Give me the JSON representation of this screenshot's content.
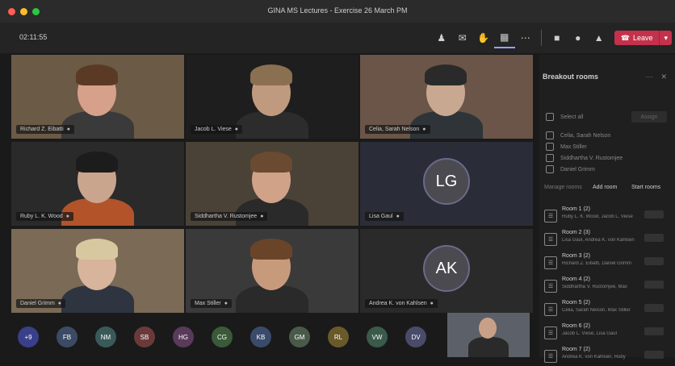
{
  "window": {
    "title": "GINA MS Lectures - Exercise 26 March PM",
    "dot_colors": [
      "#ff5f57",
      "#febc2e",
      "#28c840"
    ]
  },
  "toolbar": {
    "timer": "02:11:55",
    "icons": [
      "people-icon",
      "chat-icon",
      "hand-icon",
      "rooms-icon",
      "more-icon",
      "camera-icon",
      "mic-icon",
      "share-icon"
    ],
    "leave_label": "Leave"
  },
  "tiles": [
    {
      "name": "Richard Z. Eibatti",
      "bg": "#6b5a46",
      "kind": "person",
      "skin": "#d6a08a",
      "hair": "#5a3a25",
      "shirt": "#3a3a3a"
    },
    {
      "name": "Jacob L. Viese",
      "bg": "#1e1e1e",
      "kind": "person",
      "skin": "#c09a7e",
      "hair": "#8a7050",
      "shirt": "#2c2c2c"
    },
    {
      "name": "Celia, Sarah Nelson",
      "bg": "#6a5548",
      "kind": "person",
      "skin": "#c8a890",
      "hair": "#2a2a2a",
      "shirt": "#2e3438"
    },
    {
      "name": "Ruby L. K. Wood",
      "bg": "#2a2a2a",
      "kind": "person",
      "skin": "#c9a58e",
      "hair": "#1c1c1c",
      "shirt": "#b2532a"
    },
    {
      "name": "Siddhartha V. Rustomjee",
      "bg": "#4a4236",
      "kind": "person",
      "skin": "#d0a288",
      "hair": "#6a4a30",
      "shirt": "#2a2a2a"
    },
    {
      "name": "Lisa Gaul",
      "bg": "#2a2c38",
      "kind": "initials",
      "initials": "LG"
    },
    {
      "name": "Daniel Grimm",
      "bg": "#7a6a56",
      "kind": "person",
      "skin": "#d8b49c",
      "hair": "#d8c8a0",
      "shirt": "#2e3540"
    },
    {
      "name": "Max Stiller",
      "bg": "#3a3a3a",
      "kind": "person",
      "skin": "#c89a7c",
      "hair": "#6a4428",
      "shirt": "#2a2a2a"
    },
    {
      "name": "Andrea K. von Kahlsen",
      "bg": "#2a2a2a",
      "kind": "initials",
      "initials": "AK"
    }
  ],
  "panel": {
    "title": "Breakout rooms",
    "select_all": "Select all",
    "assign_label": "Assign",
    "participants": [
      "Celia, Sarah Nelson",
      "Max Stiller",
      "Siddhartha V. Rustomjee",
      "Daniel Grimm"
    ],
    "manage_label": "Manage rooms",
    "add_room": "Add room",
    "start_rooms": "Start rooms",
    "rooms": [
      {
        "name": "Room 1 (2)",
        "members": "Ruby L. K. Wood, Jacob L. Viese"
      },
      {
        "name": "Room 2 (3)",
        "members": "Lisa Gaul, Andrea K. von Kahlsen"
      },
      {
        "name": "Room 3 (2)",
        "members": "Richard Z. Eibatti, Daniel Grimm"
      },
      {
        "name": "Room 4 (2)",
        "members": "Siddhartha V. Rustomjee, Max"
      },
      {
        "name": "Room 5 (2)",
        "members": "Celia, Sarah Nelson, Max Stiller"
      },
      {
        "name": "Room 6 (2)",
        "members": "Jacob L. Viese, Lisa Gaul"
      },
      {
        "name": "Room 7 (2)",
        "members": "Andrea K. von Kahlsen, Ruby"
      }
    ]
  },
  "participants_bar": [
    {
      "initials": "+9",
      "color": "#3a3f8a"
    },
    {
      "initials": "FB",
      "color": "#3c4a66"
    },
    {
      "initials": "NM",
      "color": "#3a5a5a"
    },
    {
      "initials": "SB",
      "color": "#6a3a3a"
    },
    {
      "initials": "HG",
      "color": "#5a3a5a"
    },
    {
      "initials": "CG",
      "color": "#3a5a3a"
    },
    {
      "initials": "KB",
      "color": "#3a4a6a"
    },
    {
      "initials": "GM",
      "color": "#4a5a4a"
    },
    {
      "initials": "RL",
      "color": "#6a5a2a"
    },
    {
      "initials": "VW",
      "color": "#3a5a4a"
    },
    {
      "initials": "DV",
      "color": "#4a4a6a"
    }
  ]
}
